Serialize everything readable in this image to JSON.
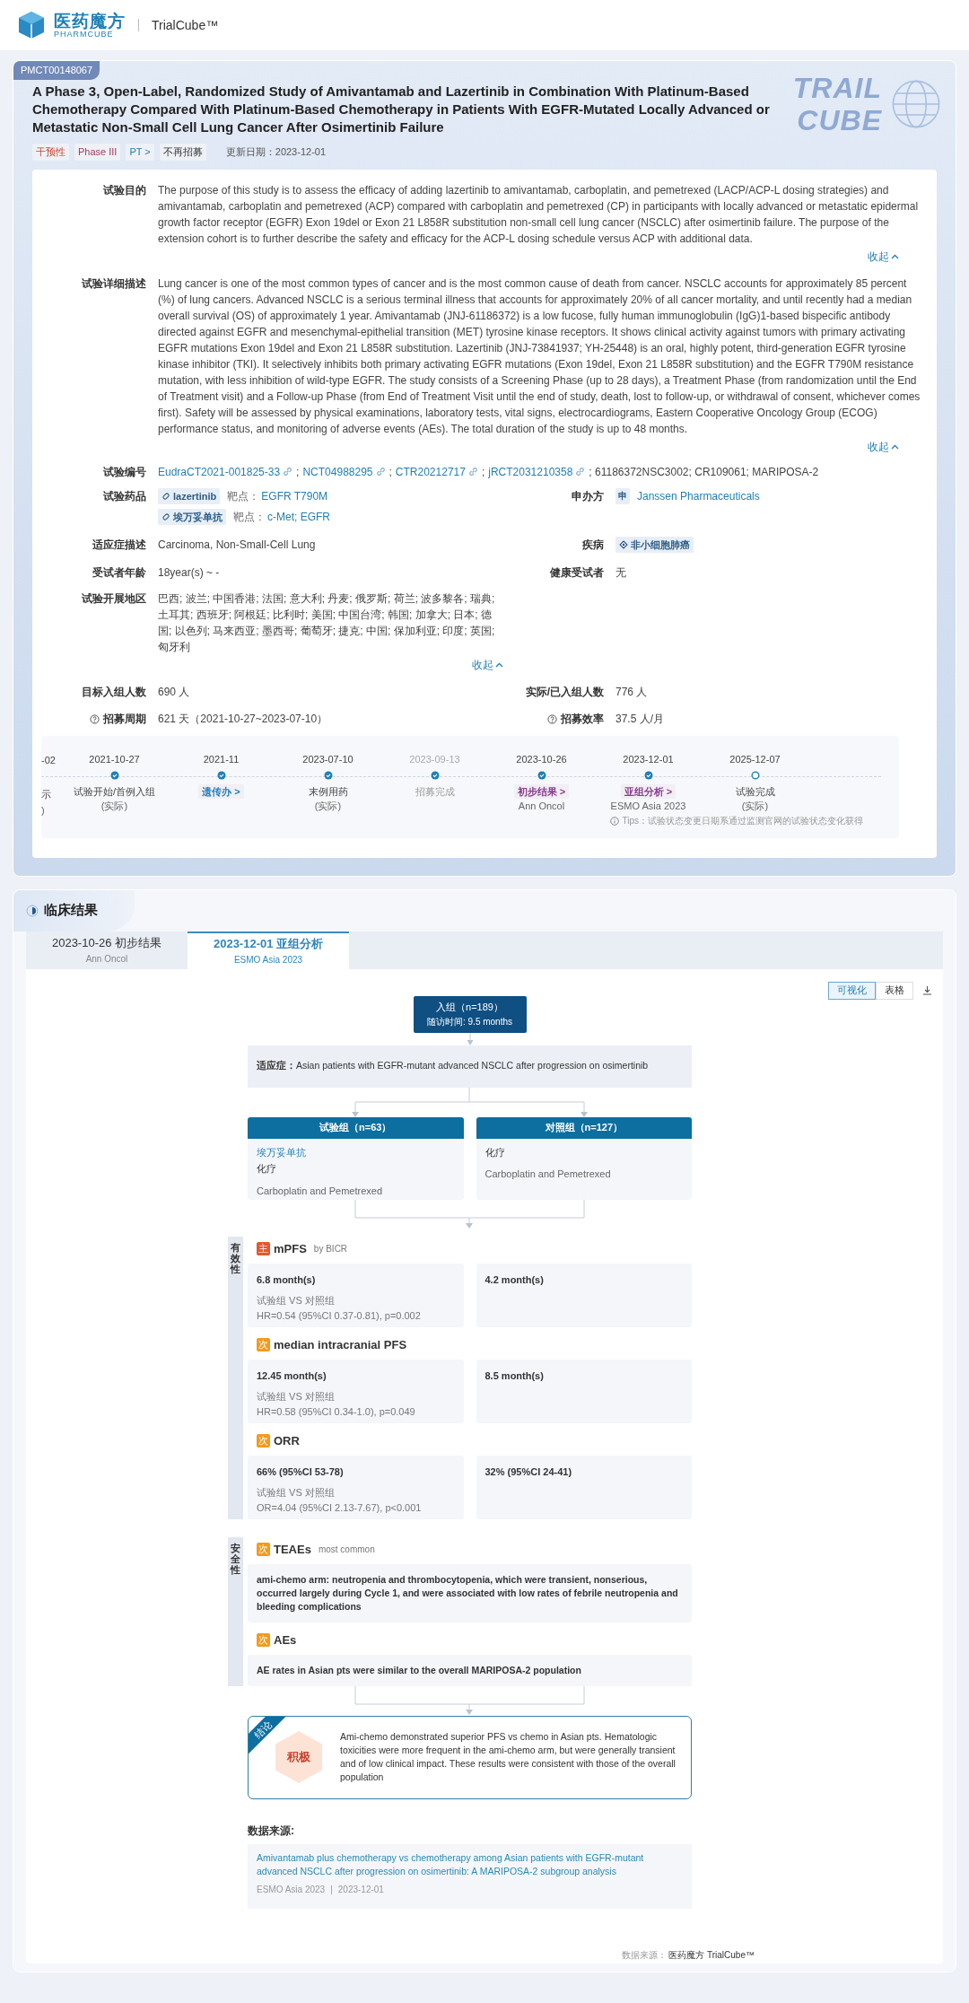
{
  "header": {
    "logo_cn": "医药魔方",
    "logo_en": "PHARMCUBE",
    "product": "TrialCube™"
  },
  "trial": {
    "id": "PMCT00148067",
    "banner_art": [
      "TRAIL",
      "CUBE"
    ],
    "title": "A Phase 3, Open-Label, Randomized Study of Amivantamab and Lazertinib in Combination With Platinum-Based Chemotherapy Compared With Platinum-Based Chemotherapy in Patients With EGFR-Mutated Locally Advanced or Metastatic Non-Small Cell Lung Cancer After Osimertinib Failure",
    "tags": [
      {
        "label": "干预性",
        "kind": "type"
      },
      {
        "label": "Phase III",
        "kind": "phase"
      },
      {
        "label": "PT >",
        "kind": "link"
      },
      {
        "label": "不再招募",
        "kind": "status"
      }
    ],
    "updated": "更新日期：2023-12-01"
  },
  "details": {
    "purpose": {
      "label": "试验目的",
      "text": "The purpose of this study is to assess the efficacy of adding lazertinib to amivantamab, carboplatin, and pemetrexed (LACP/ACP-L dosing strategies) and amivantamab, carboplatin and pemetrexed (ACP) compared with carboplatin and pemetrexed (CP) in participants with locally advanced or metastatic epidermal growth factor receptor (EGFR) Exon 19del or Exon 21 L858R substitution non-small cell lung cancer (NSCLC) after osimertinib failure. The purpose of the extension cohort is to further describe the safety and efficacy for the ACP-L dosing schedule versus ACP with additional data.",
      "collapse": "收起"
    },
    "description": {
      "label": "试验详细描述",
      "text": "Lung cancer is one of the most common types of cancer and is the most common cause of death from cancer. NSCLC accounts for approximately 85 percent (%) of lung cancers. Advanced NSCLC is a serious terminal illness that accounts for approximately 20% of all cancer mortality, and until recently had a median overall survival (OS) of approximately 1 year. Amivantamab (JNJ-61186372) is a low fucose, fully human immunoglobulin (IgG)1-based bispecific antibody directed against EGFR and mesenchymal-epithelial transition (MET) tyrosine kinase receptors. It shows clinical activity against tumors with primary activating EGFR mutations Exon 19del and Exon 21 L858R substitution. Lazertinib (JNJ-73841937; YH-25448) is an oral, highly potent, third-generation EGFR tyrosine kinase inhibitor (TKI). It selectively inhibits both primary activating EGFR mutations (Exon 19del, Exon 21 L858R substitution) and the EGFR T790M resistance mutation, with less inhibition of wild-type EGFR. The study consists of a Screening Phase (up to 28 days), a Treatment Phase (from randomization until the End of Treatment visit) and a Follow-up Phase (from End of Treatment Visit until the end of study, death, lost to follow-up, or withdrawal of consent, whichever comes first). Safety will be assessed by physical examinations, laboratory tests, vital signs, electrocardiograms, Eastern Cooperative Oncology Group (ECOG) performance status, and monitoring of adverse events (AEs). The total duration of the study is up to 48 months.",
      "collapse": "收起"
    },
    "ids": {
      "label": "试验编号",
      "items": [
        {
          "text": "EudraCT2021-001825-33",
          "link": true
        },
        {
          "text": ";",
          "link": false
        },
        {
          "text": "NCT04988295",
          "link": true
        },
        {
          "text": ";",
          "link": false
        },
        {
          "text": "CTR20212717",
          "link": true
        },
        {
          "text": ";",
          "link": false
        },
        {
          "text": "jRCT2031210358",
          "link": true
        },
        {
          "text": "; 61186372NSC3002; CR109061; MARIPOSA-2",
          "link": false
        }
      ]
    },
    "drugs": {
      "label": "试验药品",
      "items": [
        {
          "name": "lazertinib",
          "target_label": "靶点：",
          "targets": "EGFR T790M"
        },
        {
          "name": "埃万妥单抗",
          "target_label": "靶点：",
          "targets": "c-Met; EGFR"
        }
      ]
    },
    "sponsor": {
      "label": "申办方",
      "badge": "申",
      "name": "Janssen Pharmaceuticals"
    },
    "indication": {
      "label": "适应症描述",
      "value": "Carcinoma, Non-Small-Cell Lung"
    },
    "disease": {
      "label": "疾病",
      "tag": "非小细胞肺癌"
    },
    "age": {
      "label": "受试者年龄",
      "value": "18year(s) ~ -"
    },
    "healthy": {
      "label": "健康受试者",
      "value": "无"
    },
    "regions": {
      "label": "试验开展地区",
      "value": "巴西; 波兰; 中国香港; 法国; 意大利; 丹麦; 俄罗斯; 荷兰; 波多黎各; 瑞典; 土耳其; 西班牙; 阿根廷; 比利时; 美国; 中国台湾; 韩国; 加拿大; 日本; 德国; 以色列; 马来西亚; 墨西哥; 葡萄牙; 捷克; 中国; 保加利亚; 印度; 英国; 匈牙利",
      "collapse": "收起"
    },
    "target_enrollment": {
      "label": "目标入组人数",
      "value": "690 人"
    },
    "actual_enrollment": {
      "label": "实际/已入组人数",
      "value": "776 人"
    },
    "period": {
      "label": "招募周期",
      "value": "621 天（2021-10-27~2023-07-10）"
    },
    "rate": {
      "label": "招募效率",
      "value": "37.5 人/月"
    }
  },
  "timeline": {
    "items": [
      {
        "kind": "partial",
        "date": "-02",
        "label": "示",
        "sub": ")"
      },
      {
        "kind": "done",
        "date": "2021-10-27",
        "label": "试验开始/首例入组",
        "sub": "(实际)"
      },
      {
        "kind": "done",
        "date": "2021-11",
        "tag": "遗传办 >",
        "color": "#1f7fb6"
      },
      {
        "kind": "done",
        "date": "2023-07-10",
        "label": "末例用药",
        "sub": "(实际)"
      },
      {
        "kind": "inactive",
        "date": "2023-09-13",
        "label": "招募完成"
      },
      {
        "kind": "done",
        "date": "2023-10-26",
        "tag": "初步结果 >",
        "color": "#8a3f8f",
        "sub": "Ann Oncol"
      },
      {
        "kind": "done",
        "date": "2023-12-01",
        "tag": "亚组分析 >",
        "color": "#8a3f8f",
        "sub": "ESMO Asia 2023"
      },
      {
        "kind": "pending",
        "date": "2025-12-07",
        "label": "试验完成",
        "sub": "(实际)"
      }
    ],
    "tips": "Tips：试验状态变更日期系通过监测官网的试验状态变化获得"
  },
  "results": {
    "title": "临床结果",
    "tabs": [
      {
        "title": "2023-10-26 初步结果",
        "sub": "Ann Oncol",
        "selected": false
      },
      {
        "title": "2023-12-01 亚组分析",
        "sub": "ESMO Asia 2023",
        "selected": true
      }
    ],
    "views": [
      {
        "label": "可视化",
        "selected": true
      },
      {
        "label": "表格",
        "selected": false
      }
    ],
    "enrollment": {
      "title": "入组（n=189）",
      "followup": "随访时间: 9.5 months"
    },
    "indication": {
      "label": "适应症：",
      "text": "Asian patients with EGFR-mutant advanced NSCLC after progression on osimertinib"
    },
    "arms": [
      {
        "title": "试验组（n=63）",
        "drug": "埃万妥单抗",
        "lines": [
          "化疗",
          "Carboplatin and Pemetrexed"
        ]
      },
      {
        "title": "对照组（n=127）",
        "lines": [
          "化疗",
          "Carboplatin and Pemetrexed"
        ]
      }
    ],
    "sections": [
      {
        "label": "有效性",
        "endpoints": [
          {
            "badge": "主",
            "color": "#e4572e",
            "name": "mPFS",
            "note": "by BICR",
            "kind": "pair",
            "cells": [
              {
                "value": "6.8 month(s)",
                "compare": "试验组 VS 对照组",
                "stat": "HR=0.54 (95%CI 0.37-0.81), p=0.002"
              },
              {
                "value": "4.2 month(s)"
              }
            ]
          },
          {
            "badge": "次",
            "color": "#f39a1e",
            "name": "median intracranial PFS",
            "kind": "pair",
            "cells": [
              {
                "value": "12.45 month(s)",
                "compare": "试验组 VS 对照组",
                "stat": "HR=0.58 (95%CI 0.34-1.0), p=0.049"
              },
              {
                "value": "8.5 month(s)"
              }
            ]
          },
          {
            "badge": "次",
            "color": "#f39a1e",
            "name": "ORR",
            "kind": "pair",
            "cells": [
              {
                "value": "66% (95%CI 53-78)",
                "compare": "试验组 VS 对照组",
                "stat": "OR=4.04 (95%CI 2.13-7.67), p<0.001"
              },
              {
                "value": "32% (95%CI 24-41)"
              }
            ]
          }
        ]
      },
      {
        "label": "安全性",
        "endpoints": [
          {
            "badge": "次",
            "color": "#f39a1e",
            "name": "TEAEs",
            "note": "most common",
            "kind": "text",
            "text": "ami-chemo arm: neutropenia and thrombocytopenia, which were transient, nonserious, occurred largely during Cycle 1, and were associated with low rates of febrile neutropenia and bleeding complications"
          },
          {
            "badge": "次",
            "color": "#f39a1e",
            "name": "AEs",
            "kind": "text",
            "text": "AE rates in Asian pts were similar to the overall MARIPOSA-2 population"
          }
        ]
      }
    ],
    "conclusion": {
      "corner": "结论",
      "verdict": "积极",
      "text": "Ami-chemo demonstrated superior PFS vs chemo in Asian pts. Hematologic toxicities were more frequent in the ami-chemo arm, but were generally transient and of low clinical impact. These results were consistent with those of the overall population"
    },
    "source": {
      "label": "数据来源:",
      "title": "Amivantamab plus chemotherapy vs chemotherapy among Asian patients with EGFR-mutant advanced NSCLC after progression on osimertinib: A MARIPOSA-2 subgroup analysis",
      "venue": "ESMO Asia 2023",
      "sep": "|",
      "date": "2023-12-01"
    },
    "footer": {
      "label": "数据来源：",
      "brand": "医药魔方 TrialCube™"
    }
  }
}
